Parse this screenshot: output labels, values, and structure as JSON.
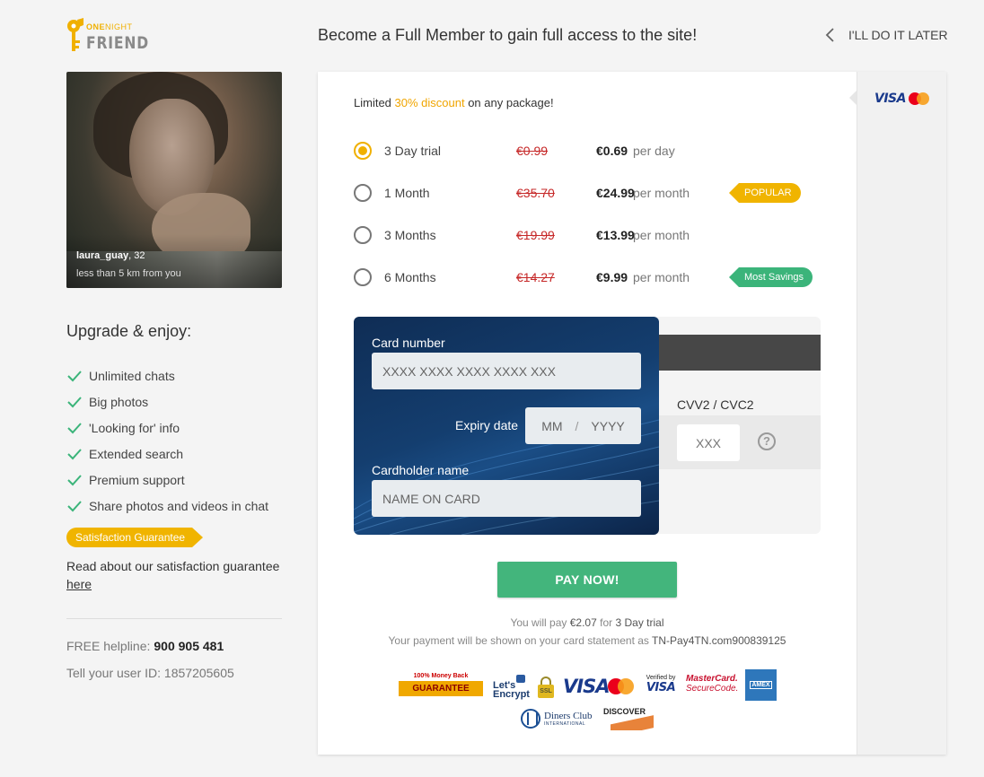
{
  "logo": {
    "line1_a": "ONE",
    "line1_b": "NIGHT",
    "line2": "FRIEND"
  },
  "header": {
    "title": "Become a Full Member to gain full access to the site!",
    "later_label": "I'LL DO IT LATER"
  },
  "profile": {
    "username": "laura_guay",
    "age": ", 32",
    "distance": "less than 5 km from you"
  },
  "benefits": {
    "title": "Upgrade & enjoy:",
    "items": [
      "Unlimited chats",
      "Big photos",
      "'Looking for' info",
      "Extended search",
      "Premium support",
      "Share photos and videos in chat"
    ],
    "badge": "Satisfaction Guarantee",
    "read_about": "Read about our satisfaction guarantee",
    "read_link": "here"
  },
  "contact": {
    "helpline_label": "FREE helpline:",
    "helpline_number": "900 905 481",
    "userid_text": "Tell your user ID: 1857205605"
  },
  "payment": {
    "discount": {
      "prefix": "Limited ",
      "highlight": "30% discount",
      "suffix": " on any package!"
    },
    "accent_color": "#f0b000",
    "plans": [
      {
        "name": "3 Day trial",
        "old_price": "€0.99",
        "price": "€0.69",
        "per": "per day",
        "selected": true,
        "tag": ""
      },
      {
        "name": "1 Month",
        "old_price": "€35.70",
        "price": "€24.99",
        "per": "per month",
        "selected": false,
        "tag": "POPULAR"
      },
      {
        "name": "3 Months",
        "old_price": "€19.99",
        "price": "€13.99",
        "per": "per month",
        "selected": false,
        "tag": ""
      },
      {
        "name": "6 Months",
        "old_price": "€14.27",
        "price": "€9.99",
        "per": "per month",
        "selected": false,
        "tag": "Most Savings"
      }
    ],
    "card": {
      "number_label": "Card number",
      "number_placeholder": "XXXX XXXX XXXX XXXX XXX",
      "expiry_label": "Expiry date",
      "month_placeholder": "MM",
      "expiry_sep": "/",
      "year_placeholder": "YYYY",
      "holder_label": "Cardholder name",
      "holder_placeholder": "NAME ON CARD",
      "cvv_label": "CVV2 / CVC2",
      "cvv_placeholder": "XXX",
      "help_glyph": "?"
    },
    "pay_button": "PAY NOW!",
    "summary": {
      "line1_a": "You will pay",
      "amount": "€2.07",
      "line1_b": "for",
      "plan": "3 Day trial",
      "line2_a": "Your payment will be shown on your card statement as",
      "descriptor": "TN-Pay4TN.com900839125"
    },
    "side_cards": {
      "visa": "VISA"
    }
  },
  "trust": {
    "mbg_top": "100% Money Back",
    "mbg_ribbon": "GUARANTEE",
    "le_line1": "Let's",
    "le_line2": "Encrypt",
    "ssl": "SSL",
    "visa": "VISA",
    "vbv_small": "Verified by",
    "vbv_visa": "VISA",
    "mcsc_line1": "MasterCard.",
    "mcsc_line2": "SecureCode.",
    "amex": "AMEX",
    "diners_line1": "Diners Club",
    "diners_line2": "INTERNATIONAL",
    "discover": "DISCOVER"
  }
}
